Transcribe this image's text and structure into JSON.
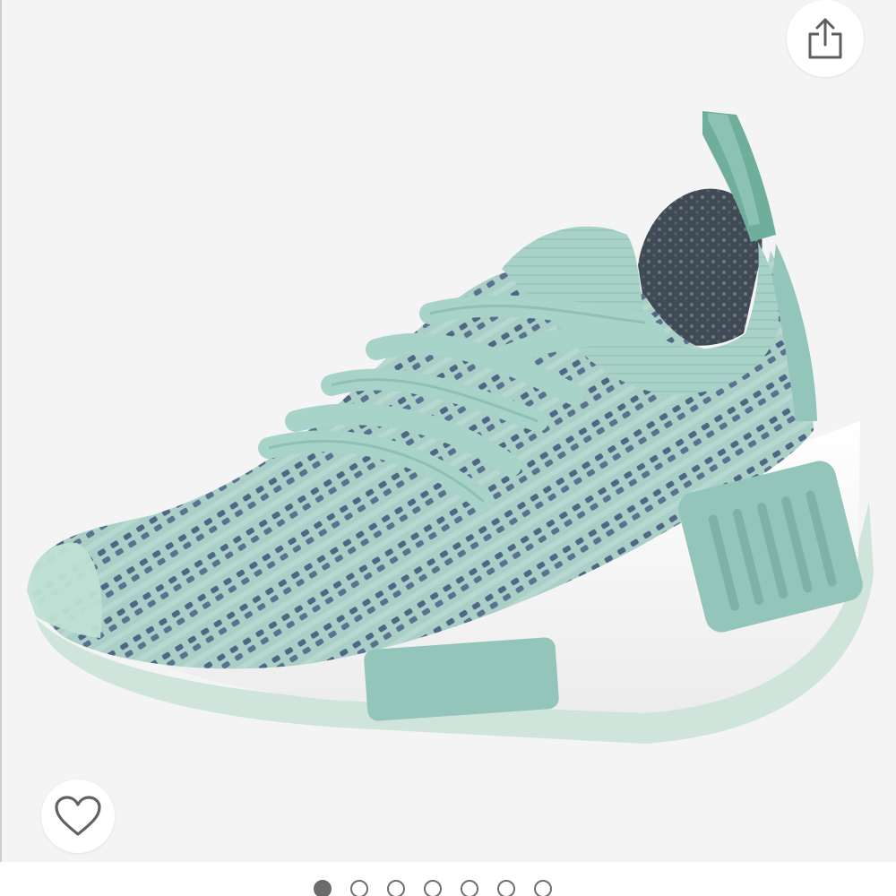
{
  "product_image": {
    "subject": "sneaker",
    "colors": {
      "knit_light": "#a9cfc7",
      "knit_stripe": "#4f6685",
      "sole": "#ffffff",
      "plug": "#8fc2b8",
      "lining": "#4a5560"
    }
  },
  "share_button": {
    "icon": "share-icon"
  },
  "wishlist_button": {
    "icon": "heart-outline-icon",
    "active": false
  },
  "pager": {
    "total": 7,
    "current": 1
  },
  "accent": "#6b6b6b"
}
